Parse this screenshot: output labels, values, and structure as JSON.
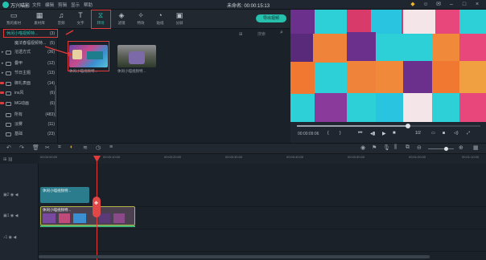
{
  "app": {
    "name": "万兴喵影",
    "project_title": "未命名: 00:00:15:13"
  },
  "menu": [
    "文件",
    "编辑",
    "剪辑",
    "显示",
    "帮助"
  ],
  "toolbar": {
    "tools": [
      {
        "label": "我的素材",
        "icon": "folder-icon"
      },
      {
        "label": "素材库",
        "icon": "library-icon"
      },
      {
        "label": "音频",
        "icon": "music-icon"
      },
      {
        "label": "文字",
        "icon": "text-icon"
      },
      {
        "label": "转场",
        "icon": "transition-icon",
        "active": true
      },
      {
        "label": "滤镜",
        "icon": "filter-icon"
      },
      {
        "label": "特效",
        "icon": "effects-icon"
      },
      {
        "label": "贴纸",
        "icon": "sticker-icon"
      },
      {
        "label": "分屏",
        "icon": "splitscreen-icon"
      }
    ],
    "export_label": "导出视频"
  },
  "categories": [
    {
      "label": "休闲小喵视频特...",
      "count": "(3)",
      "selected": true
    },
    {
      "label": "魔法春福视频特...",
      "count": "(5)"
    },
    {
      "label": "溶透方式",
      "count": "(36)"
    },
    {
      "label": "叠甲",
      "count": "(12)"
    },
    {
      "label": "节日主题",
      "count": "(13)"
    },
    {
      "label": "御礼表面",
      "count": "(14)"
    },
    {
      "label": "ins风",
      "count": "(6)"
    },
    {
      "label": "MG动画",
      "count": "(6)"
    },
    {
      "label": "所有",
      "count": "(483)"
    },
    {
      "label": "淡雾",
      "count": "(11)"
    },
    {
      "label": "基础",
      "count": "(23)"
    }
  ],
  "browser": {
    "search_placeholder": "搜索",
    "items": [
      {
        "label": "休闲小喵视频特..."
      },
      {
        "label": "休闲小喵视频特..."
      }
    ]
  },
  "player": {
    "timecode": "00:00:09:06",
    "quality": "1/2"
  },
  "ruler": [
    "00:00:00:00",
    "00:00:10:00",
    "00:00:20:00",
    "00:00:30:00",
    "00:00:40:00",
    "00:00:50:00",
    "00:01:00:00",
    "00:01:10:00"
  ],
  "timeline": {
    "title_clip_label": "休闲小喵视频特...",
    "video_clip_label": "休闲小喵视频特..."
  },
  "colors": {
    "accent": "#25c1ad",
    "highlight": "#e23b3b"
  }
}
